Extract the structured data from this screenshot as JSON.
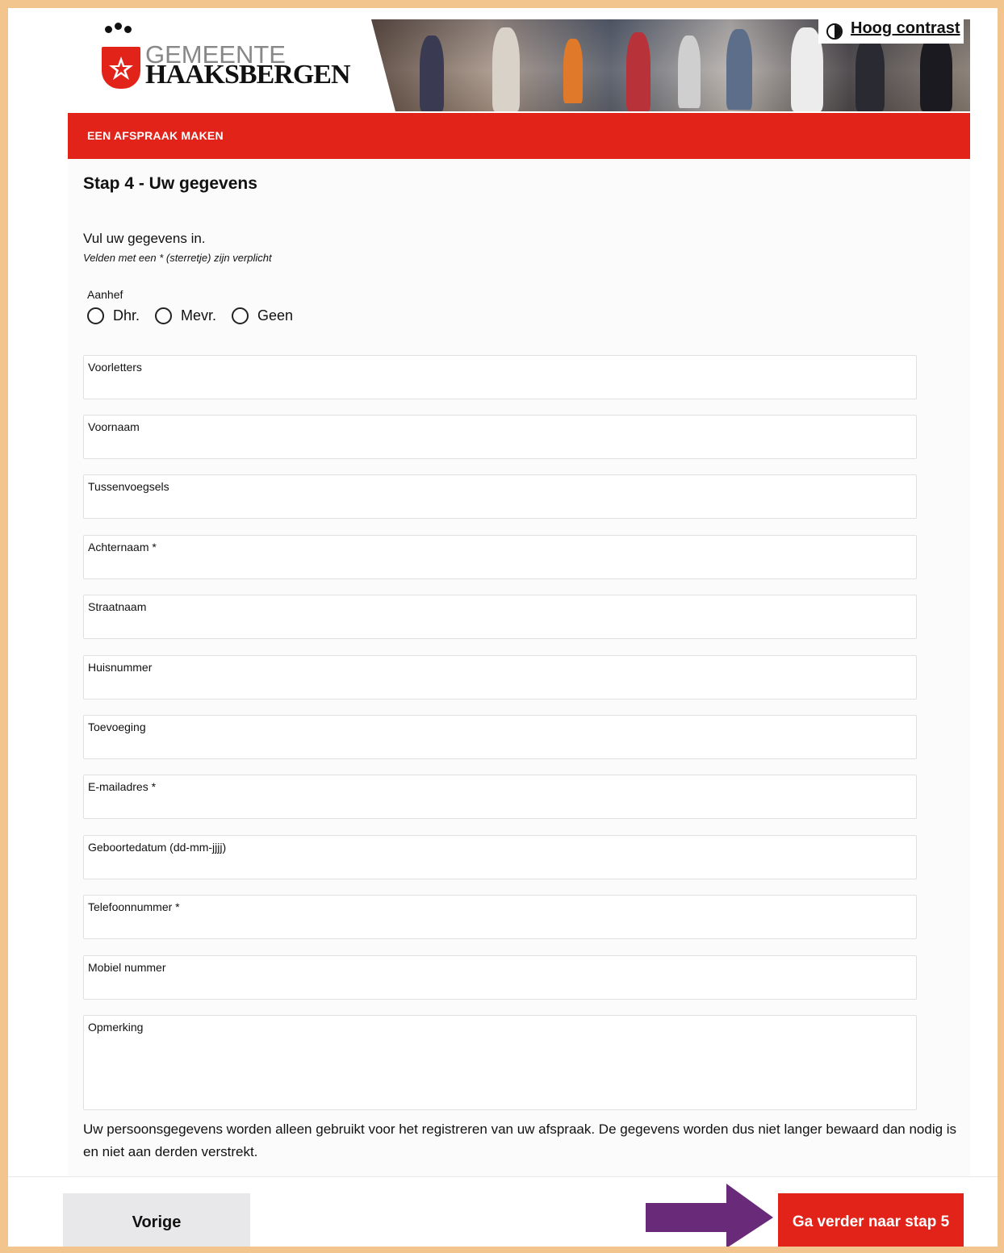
{
  "header": {
    "logo_line1": "GEMEENTE",
    "logo_line2": "HAAKSBERGEN",
    "contrast_label": "Hoog contrast"
  },
  "section_title": "EEN AFSPRAAK MAKEN",
  "step_title": "Stap 4 - Uw gegevens",
  "intro": "Vul uw gegevens in.",
  "required_note": "Velden met een * (sterretje) zijn verplicht",
  "salutation": {
    "label": "Aanhef",
    "options": [
      "Dhr.",
      "Mevr.",
      "Geen"
    ],
    "selected": null
  },
  "fields": [
    {
      "label": "Voorletters",
      "value": ""
    },
    {
      "label": "Voornaam",
      "value": ""
    },
    {
      "label": "Tussenvoegsels",
      "value": ""
    },
    {
      "label": "Achternaam *",
      "value": ""
    },
    {
      "label": "Straatnaam",
      "value": ""
    },
    {
      "label": "Huisnummer",
      "value": ""
    },
    {
      "label": "Toevoeging",
      "value": ""
    },
    {
      "label": "E-mailadres *",
      "value": ""
    },
    {
      "label": "Geboortedatum (dd-mm-jjjj)",
      "value": ""
    },
    {
      "label": "Telefoonnummer *",
      "value": ""
    },
    {
      "label": "Mobiel nummer",
      "value": ""
    },
    {
      "label": "Opmerking",
      "value": ""
    }
  ],
  "privacy_text": "Uw persoonsgegevens worden alleen gebruikt voor het registreren van uw afspraak. De gegevens worden dus niet langer bewaard dan nodig is en niet aan derden verstrekt.",
  "footer": {
    "prev_label": "Vorige",
    "next_label": "Ga verder naar stap 5"
  },
  "colors": {
    "brand_red": "#e2231a",
    "frame_border": "#f3c58e",
    "annotation_arrow": "#6a2a7a"
  }
}
